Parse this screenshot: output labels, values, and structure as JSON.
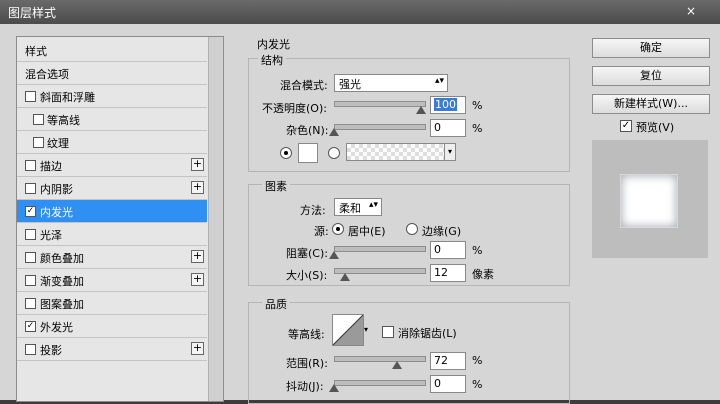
{
  "window": {
    "title": "图层样式",
    "close": "×"
  },
  "list": {
    "items": [
      {
        "label": "样式",
        "checkbox": false,
        "checked": false,
        "plus": false,
        "selected": false,
        "indent": false
      },
      {
        "label": "混合选项",
        "checkbox": false,
        "checked": false,
        "plus": false,
        "selected": false,
        "indent": false
      },
      {
        "label": "斜面和浮雕",
        "checkbox": true,
        "checked": false,
        "plus": false,
        "selected": false,
        "indent": false
      },
      {
        "label": "等高线",
        "checkbox": true,
        "checked": false,
        "plus": false,
        "selected": false,
        "indent": true
      },
      {
        "label": "纹理",
        "checkbox": true,
        "checked": false,
        "plus": false,
        "selected": false,
        "indent": true
      },
      {
        "label": "描边",
        "checkbox": true,
        "checked": false,
        "plus": true,
        "selected": false,
        "indent": false
      },
      {
        "label": "内阴影",
        "checkbox": true,
        "checked": false,
        "plus": true,
        "selected": false,
        "indent": false
      },
      {
        "label": "内发光",
        "checkbox": true,
        "checked": true,
        "plus": false,
        "selected": true,
        "indent": false
      },
      {
        "label": "光泽",
        "checkbox": true,
        "checked": false,
        "plus": false,
        "selected": false,
        "indent": false
      },
      {
        "label": "颜色叠加",
        "checkbox": true,
        "checked": false,
        "plus": true,
        "selected": false,
        "indent": false
      },
      {
        "label": "渐变叠加",
        "checkbox": true,
        "checked": false,
        "plus": true,
        "selected": false,
        "indent": false
      },
      {
        "label": "图案叠加",
        "checkbox": true,
        "checked": false,
        "plus": false,
        "selected": false,
        "indent": false
      },
      {
        "label": "外发光",
        "checkbox": true,
        "checked": true,
        "plus": false,
        "selected": false,
        "indent": false
      },
      {
        "label": "投影",
        "checkbox": true,
        "checked": false,
        "plus": true,
        "selected": false,
        "indent": false
      }
    ]
  },
  "panel": {
    "title": "内发光",
    "structure": {
      "title": "结构",
      "blend_label": "混合模式:",
      "blend_value": "强光",
      "opacity_label": "不透明度(O):",
      "opacity_value": "100",
      "opacity_unit": "%",
      "noise_label": "杂色(N):",
      "noise_value": "0",
      "noise_unit": "%"
    },
    "elements": {
      "title": "图素",
      "method_label": "方法:",
      "method_value": "柔和",
      "source_label": "源:",
      "source_center": "居中(E)",
      "source_edge": "边缘(G)",
      "choke_label": "阻塞(C):",
      "choke_value": "0",
      "choke_unit": "%",
      "size_label": "大小(S):",
      "size_value": "12",
      "size_unit": "像素"
    },
    "quality": {
      "title": "品质",
      "contour_label": "等高线:",
      "antialias_label": "消除锯齿(L)",
      "range_label": "范围(R):",
      "range_value": "72",
      "range_unit": "%",
      "jitter_label": "抖动(J):",
      "jitter_value": "0",
      "jitter_unit": "%"
    }
  },
  "buttons": {
    "ok": "确定",
    "reset": "复位",
    "new_style": "新建样式(W)...",
    "preview_label": "预览(V)"
  }
}
